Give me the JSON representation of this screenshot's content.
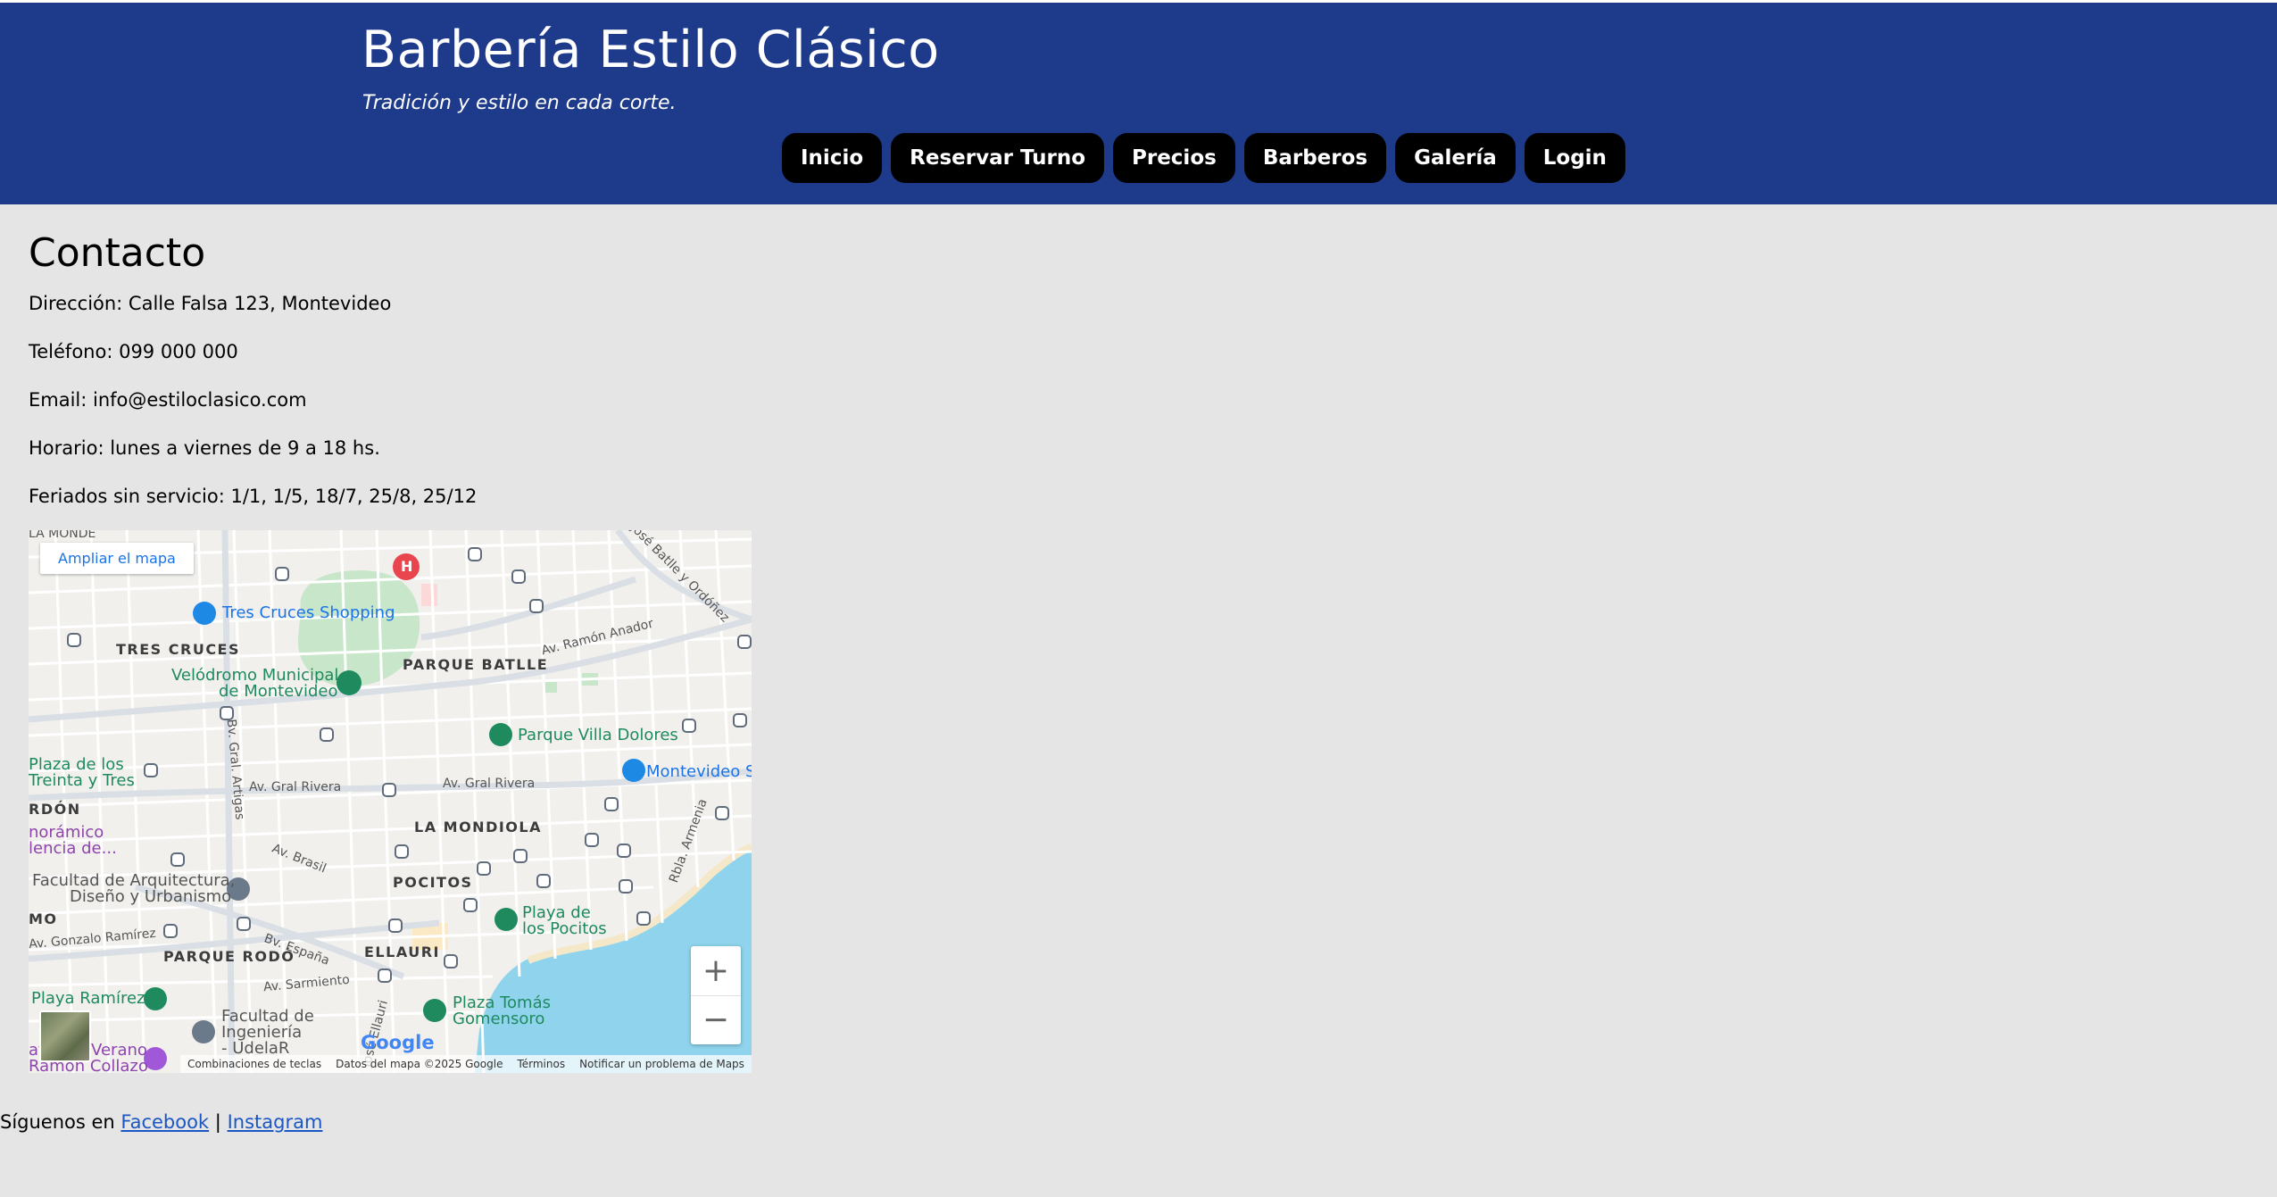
{
  "header": {
    "title": "Barbería Estilo Clásico",
    "tagline": "Tradición y estilo en cada corte.",
    "nav": [
      "Inicio",
      "Reservar Turno",
      "Precios",
      "Barberos",
      "Galería",
      "Login"
    ],
    "background_color": "#1e3a8a"
  },
  "contact": {
    "heading": "Contacto",
    "address": "Dirección: Calle Falsa 123, Montevideo",
    "phone": "Teléfono: 099 000 000",
    "email": "Email: info@estiloclasico.com",
    "hours": "Horario: lunes a viernes de 9 a 18 hs.",
    "holidays": "Feriados sin servicio: 1/1, 1/5, 18/7, 25/8, 25/12"
  },
  "map": {
    "expand_label": "Ampliar el mapa",
    "zoom_in": "+",
    "zoom_out": "−",
    "logo": "Google",
    "attribution": {
      "shortcuts": "Combinaciones de teclas",
      "data": "Datos del mapa ©2025 Google",
      "terms": "Términos",
      "report": "Notificar un problema de Maps"
    },
    "labels": {
      "tres_cruces_shopping": "Tres Cruces Shopping",
      "tres_cruces": "TRES CRUCES",
      "velodromo_1": "Velódromo Municipal",
      "velodromo_2": "de Montevideo",
      "parque_batlle": "PARQUE BATLLE",
      "ramon_anador": "Av. Ramón Anador",
      "jose_batlle": "José Batlle y Ordóñez",
      "parque_villa_dolores": "Parque Villa Dolores",
      "montevideo_shopping": "Montevideo Sh",
      "plaza_treinta_1": "Plaza de los",
      "plaza_treinta_2": "Treinta y Tres",
      "cordon": "RDÓN",
      "gral_rivera_1": "Av. Gral Rivera",
      "gral_rivera_2": "Av. Gral Rivera",
      "bv_artigas": "Bv. Gral. Artigas",
      "la_mondiola": "LA MONDIOLA",
      "panoramico_1": "norámico",
      "panoramico_2": "lencia de...",
      "av_brasil": "Av. Brasil",
      "rbla_armenia": "Rbla. Armenia",
      "pocitos": "POCITOS",
      "facultad_arq_1": "Facultad de Arquitectura,",
      "facultad_arq_2": "Diseño y Urbanismo",
      "mo": "MO",
      "playa_pocitos_1": "Playa de",
      "playa_pocitos_2": "los Pocitos",
      "gonzalo_ramirez": "Av. Gonzalo Ramírez",
      "parque_rodo": "PARQUE RODÓ",
      "bv_espana": "Bv. España",
      "ellauri": "ELLAURI",
      "av_sarmiento": "Av. Sarmiento",
      "playa_ramirez": "Playa Ramírez",
      "plaza_gomensoro_1": "Plaza Tomás",
      "plaza_gomensoro_2": "Gomensoro",
      "facultad_ing_1": "Facultad de",
      "facultad_ing_2": "Ingeniería",
      "facultad_ing_3": "- UdelaR",
      "jose_ellauri": "José Ellauri",
      "teatro_verano_1": "atro de Verano",
      "teatro_verano_2": "Ramón Collazo",
      "la_mondiola_top": "LA MONDE",
      "hospital": "H"
    }
  },
  "footer": {
    "prefix": "Síguenos en",
    "facebook": "Facebook",
    "separator": "|",
    "instagram": "Instagram"
  }
}
